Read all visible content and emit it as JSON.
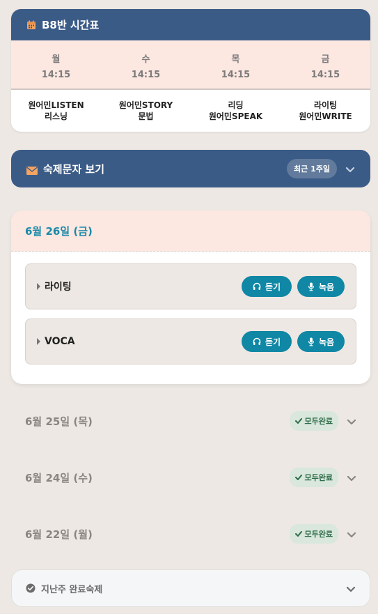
{
  "timetable": {
    "title": "B8반 시간표",
    "days": [
      {
        "day": "월",
        "time": "14:15",
        "subject_line1": "원어민LISTEN",
        "subject_line2": "리스닝"
      },
      {
        "day": "수",
        "time": "14:15",
        "subject_line1": "원어민STORY",
        "subject_line2": "문법"
      },
      {
        "day": "목",
        "time": "14:15",
        "subject_line1": "리딩",
        "subject_line2": "원어민SPEAK"
      },
      {
        "day": "금",
        "time": "14:15",
        "subject_line1": "라이팅",
        "subject_line2": "원어민WRITE"
      }
    ]
  },
  "messages": {
    "title": "숙제문자 보기",
    "filter_label": "최근 1주일"
  },
  "active_day": {
    "date": "6월 26일 (금)",
    "items": [
      {
        "name": "라이팅",
        "listen_label": "듣기",
        "record_label": "녹음"
      },
      {
        "name": "VOCA",
        "listen_label": "듣기",
        "record_label": "녹음"
      }
    ]
  },
  "collapsed_days": [
    {
      "date": "6월 25일 (목)",
      "status": "모두완료"
    },
    {
      "date": "6월 24일 (수)",
      "status": "모두완료"
    },
    {
      "date": "6월 22일 (월)",
      "status": "모두완료"
    }
  ],
  "past_week": {
    "title": "지난주 완료숙제"
  },
  "colors": {
    "header_blue": "#3b5b87",
    "accent_teal": "#0f87a5",
    "date_teal": "#1b8aa8",
    "peach": "#fce7e1",
    "background": "#ede8e3",
    "done_green": "#2d6b47",
    "calendar_orange": "#f4a460"
  }
}
